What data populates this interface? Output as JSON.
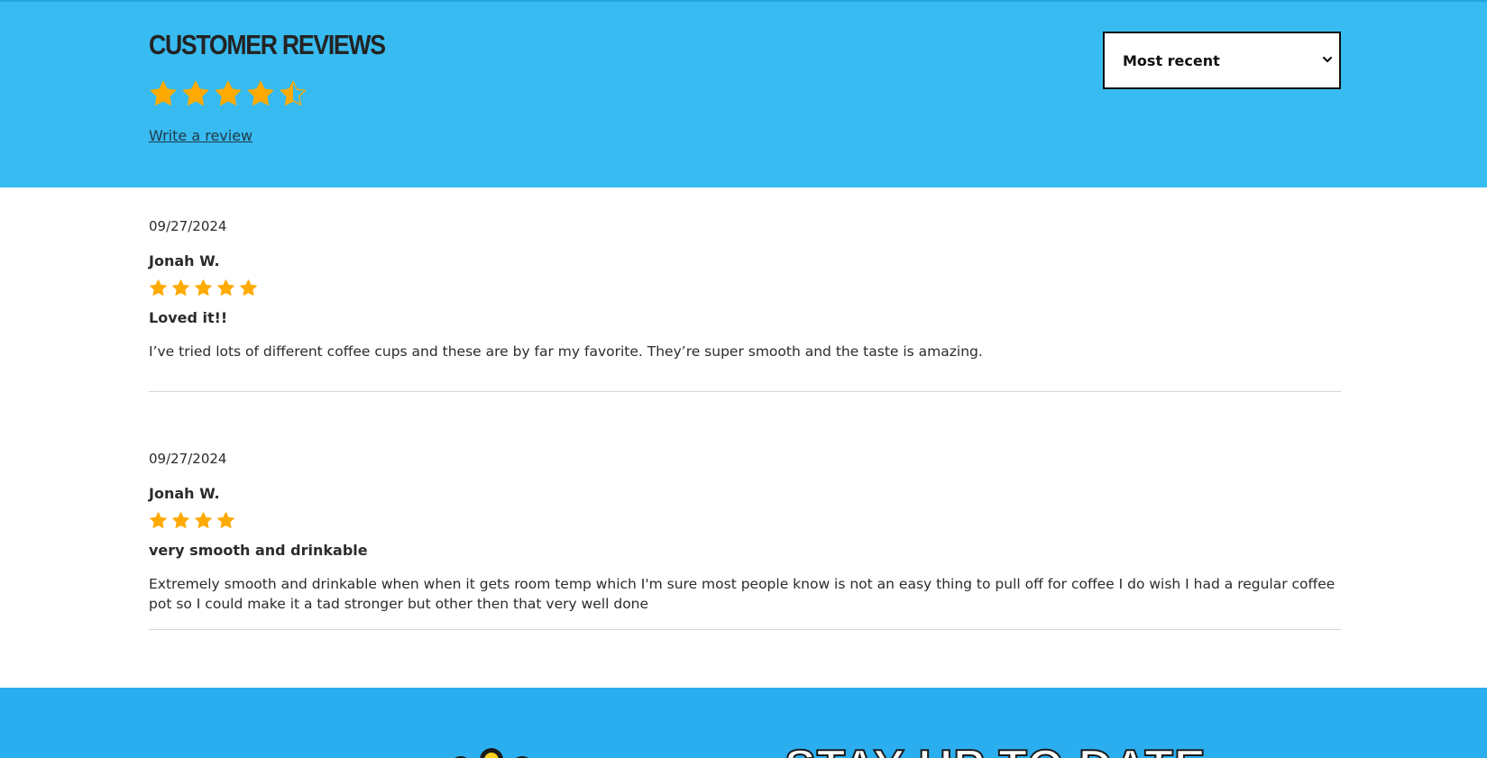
{
  "header": {
    "title": "Customer Reviews",
    "average_rating": 4.5,
    "max_rating": 5,
    "write_review_label": "Write a review",
    "sort": {
      "selected": "Most recent"
    }
  },
  "reviews": [
    {
      "date": "09/27/2024",
      "author": "Jonah W.",
      "rating": 5,
      "title": "Loved it!!",
      "body": "I’ve tried lots of different coffee cups and these are by far my favorite. They’re super smooth and the taste is amazing."
    },
    {
      "date": "09/27/2024",
      "author": "Jonah W.",
      "rating": 4,
      "title": "very smooth and drinkable",
      "body": "Extremely smooth and drinkable when when it gets room temp which I'm sure most people know is not an easy thing to pull off for coffee I do wish I had a regular coffee pot so I could make it a tad stronger but other then that very well done"
    }
  ],
  "footer": {
    "headline": "Stay up to date"
  },
  "colors": {
    "header_bg": "#38bbf0",
    "footer_bg": "#2baef0",
    "star": "#ffaa00"
  }
}
